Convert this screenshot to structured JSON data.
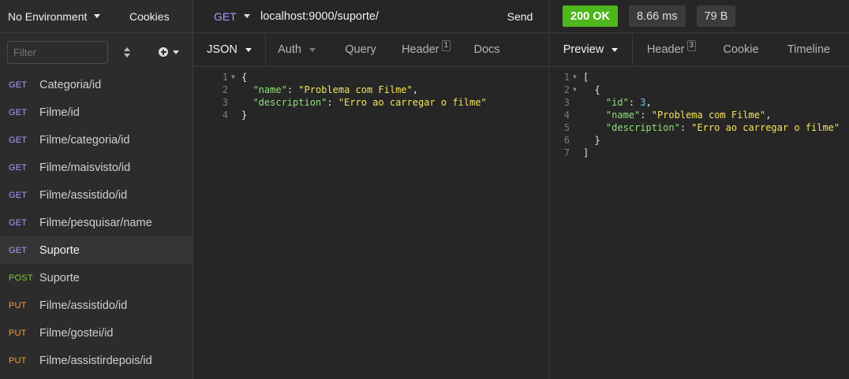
{
  "sidebar": {
    "environment_label": "No Environment",
    "cookies_label": "Cookies",
    "filter_placeholder": "Filter",
    "requests": [
      {
        "method": "GET",
        "name": "Categoria/id",
        "active": false
      },
      {
        "method": "GET",
        "name": "Filme/id",
        "active": false
      },
      {
        "method": "GET",
        "name": "Filme/categoria/id",
        "active": false
      },
      {
        "method": "GET",
        "name": "Filme/maisvisto/id",
        "active": false
      },
      {
        "method": "GET",
        "name": "Filme/assistido/id",
        "active": false
      },
      {
        "method": "GET",
        "name": "Filme/pesquisar/name",
        "active": false
      },
      {
        "method": "GET",
        "name": "Suporte",
        "active": true
      },
      {
        "method": "POST",
        "name": "Suporte",
        "active": false
      },
      {
        "method": "PUT",
        "name": "Filme/assistido/id",
        "active": false
      },
      {
        "method": "PUT",
        "name": "Filme/gostei/id",
        "active": false
      },
      {
        "method": "PUT",
        "name": "Filme/assistirdepois/id",
        "active": false
      }
    ]
  },
  "request": {
    "method": "GET",
    "url": "localhost:9000/suporte/",
    "send_label": "Send",
    "tabs": {
      "json": "JSON",
      "auth": "Auth",
      "query": "Query",
      "header": "Header",
      "header_count": "1",
      "docs": "Docs"
    },
    "body_lines": [
      "1",
      "2",
      "3",
      "4"
    ],
    "body": {
      "key_name": "\"name\"",
      "val_name": "\"Problema com Filme\"",
      "key_description": "\"description\"",
      "val_description": "\"Erro ao carregar o filme\""
    }
  },
  "response": {
    "status": "200 OK",
    "time": "8.66 ms",
    "size": "79 B",
    "tabs": {
      "preview": "Preview",
      "header": "Header",
      "header_count": "3",
      "cookie": "Cookie",
      "timeline": "Timeline"
    },
    "body_lines": [
      "1",
      "2",
      "3",
      "4",
      "5",
      "6",
      "7"
    ],
    "body": {
      "key_id": "\"id\"",
      "val_id": "3",
      "key_name": "\"name\"",
      "val_name": "\"Problema com Filme\"",
      "key_description": "\"description\"",
      "val_description": "\"Erro ao carregar o filme\""
    }
  },
  "colors": {
    "get": "#a89cff",
    "post": "#80c93a",
    "put": "#ff9c2a",
    "status_ok": "#4db71b",
    "json_key": "#8fe07a",
    "json_string": "#f5e45e",
    "json_number": "#6cc7ff"
  },
  "icons": {
    "add": "plus-circle-icon",
    "sort": "sort-icon",
    "dropdown": "chevron-down-icon",
    "fold": "fold-arrow-icon"
  }
}
